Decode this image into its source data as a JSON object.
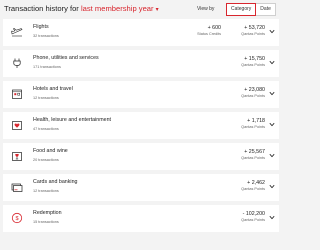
{
  "header": {
    "title_prefix": "Transaction history for",
    "title_period": "last membership year",
    "view_by_label": "View by",
    "toggle": {
      "category": "Category",
      "date": "Date"
    }
  },
  "colors": {
    "accent": "#d8262e"
  },
  "rows": [
    {
      "icon": "plane-icon",
      "name": "Flights",
      "count": "32 transactions",
      "status_credits": "+ 600",
      "status_label": "Status Credits",
      "points": "+ 53,720",
      "points_label": "Qantas Points"
    },
    {
      "icon": "plug-icon",
      "name": "Phone, utilities and services",
      "count": "171 transactions",
      "points": "+ 15,750",
      "points_label": "Qantas Points"
    },
    {
      "icon": "hotel-icon",
      "name": "Hotels and travel",
      "count": "12 transactions",
      "points": "+ 23,080",
      "points_label": "Qantas Points"
    },
    {
      "icon": "heart-icon",
      "name": "Health, leisure and entertainment",
      "count": "47 transactions",
      "points": "+ 1,718",
      "points_label": "Qantas Points"
    },
    {
      "icon": "wine-icon",
      "name": "Food and wine",
      "count": "20 transactions",
      "points": "+ 25,567",
      "points_label": "Qantas Points"
    },
    {
      "icon": "card-icon",
      "name": "Cards and banking",
      "count": "12 transactions",
      "points": "+ 2,462",
      "points_label": "Qantas Points"
    },
    {
      "icon": "redemption-icon",
      "name": "Redemption",
      "count": "15 transactions",
      "points": "- 102,200",
      "points_label": "Qantas Points"
    }
  ]
}
